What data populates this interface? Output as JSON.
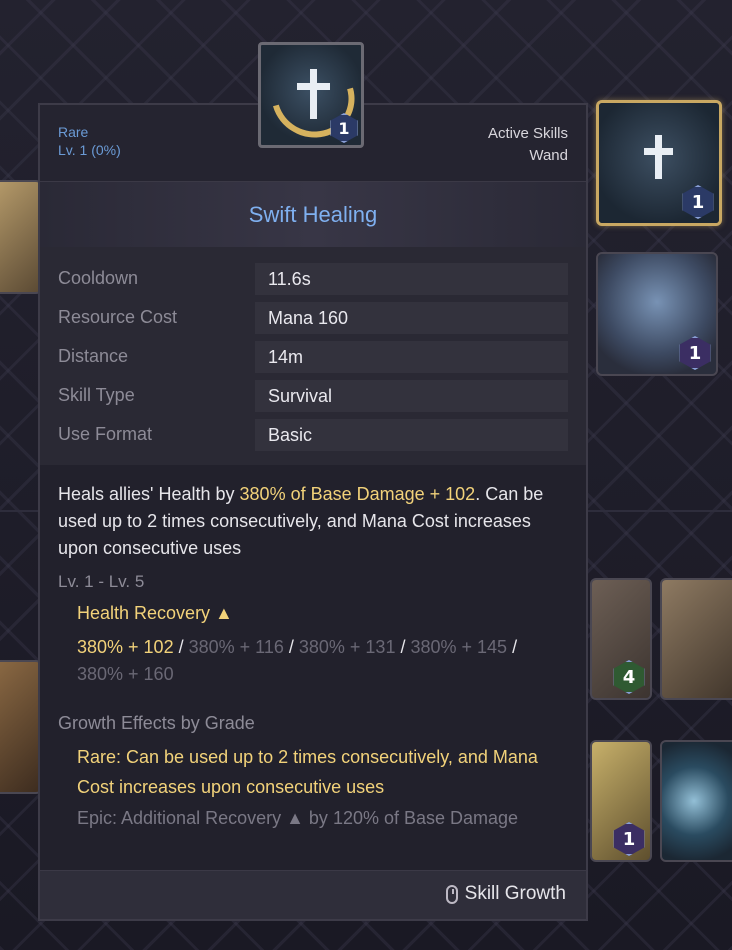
{
  "tooltip": {
    "grade": "Rare",
    "level": "Lv. 1 (0%)",
    "category": "Active Skills",
    "weapon": "Wand",
    "title": "Swift Healing",
    "stats": [
      {
        "label": "Cooldown",
        "value": "11.6s"
      },
      {
        "label": "Resource Cost",
        "value": "Mana 160"
      },
      {
        "label": "Distance",
        "value": "14m"
      },
      {
        "label": "Skill Type",
        "value": "Survival"
      },
      {
        "label": "Use Format",
        "value": "Basic"
      }
    ],
    "description": {
      "part1": "Heals allies' Health by ",
      "highlight": "380% of Base Damage + 102",
      "part2": ". Can be used up to 2 times consecutively, and Mana Cost increases upon consecutive uses"
    },
    "level_range": "Lv. 1 - Lv. 5",
    "recovery_label": "Health Recovery ▲",
    "recovery_values": [
      "380% + 102",
      "380% + 116",
      "380% + 131",
      "380% + 145",
      "380% + 160"
    ],
    "separator": " / ",
    "growth_label": "Growth Effects by Grade",
    "growth_rare": "Rare: Can be used up to 2 times consecutively, and Mana Cost increases upon consecutive uses",
    "growth_epic": "Epic: Additional Recovery ▲ by 120% of Base Damage",
    "footer_label": "Skill Growth"
  },
  "skill_icon": {
    "name": "swift-healing-cross",
    "level": "1"
  },
  "background_tiles": [
    {
      "name": "swift-healing",
      "level": "1"
    },
    {
      "name": "angel-wings",
      "level": "1"
    },
    {
      "name": "chain",
      "level": "4"
    },
    {
      "name": "crescent-moon",
      "level": ""
    },
    {
      "name": "golden-icon",
      "level": "1"
    }
  ],
  "colors": {
    "grade_rare": "#6b9bd6",
    "title": "#7fb0f0",
    "highlight": "#f2d27a",
    "muted": "#8d8b97"
  }
}
